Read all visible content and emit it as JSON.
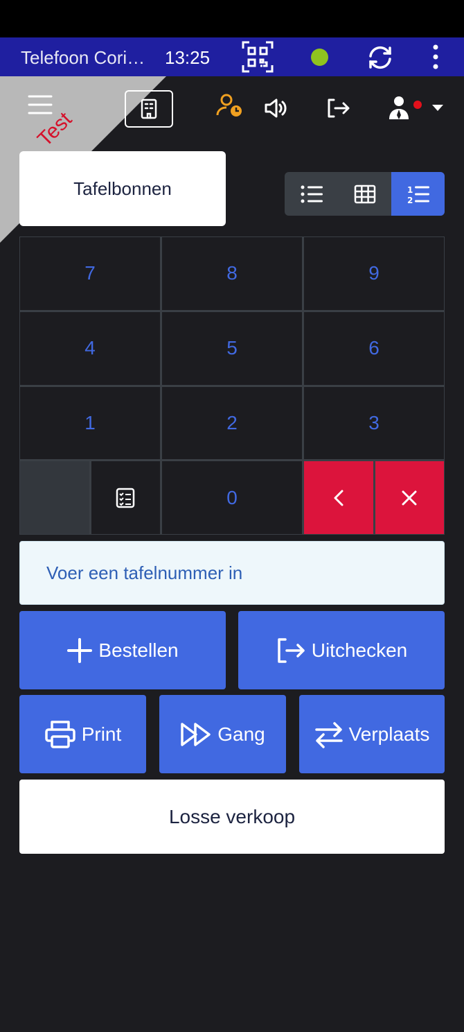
{
  "statusbar": {
    "title": "Telefoon Cori…",
    "time": "13:25",
    "qr_icon": "qr-code-icon",
    "status_color": "#8fc31f",
    "sync_icon": "sync-icon",
    "menu_icon": "kebab-menu-icon",
    "bar_color": "#1f1fa0"
  },
  "header": {
    "ribbon_label": "Test",
    "menu_icon": "hamburger-icon",
    "building_icon": "building-icon",
    "staff_icon": "user-clock-icon",
    "sound_icon": "volume-icon",
    "logout_icon": "logout-icon",
    "user_icon": "user-icon"
  },
  "tabs": {
    "active_label": "Tafelbonnen"
  },
  "view_toggle": {
    "options": [
      "list-icon",
      "grid-icon",
      "numbered-list-icon"
    ],
    "active": "numbered-list-icon"
  },
  "keypad": {
    "keys": [
      "7",
      "8",
      "9",
      "4",
      "5",
      "6",
      "1",
      "2",
      "3"
    ],
    "zero": "0"
  },
  "input": {
    "placeholder": "Voer een tafelnummer in"
  },
  "actions": {
    "order_label": "Bestellen",
    "checkout_label": "Uitchecken",
    "print_label": "Print",
    "course_label": "Gang",
    "move_label": "Verplaats",
    "loose_sale_label": "Losse verkoop"
  },
  "colors": {
    "accent": "#4169e1",
    "danger": "#dc143c",
    "background": "#1c1c20",
    "ribbon": "#d5112b"
  }
}
